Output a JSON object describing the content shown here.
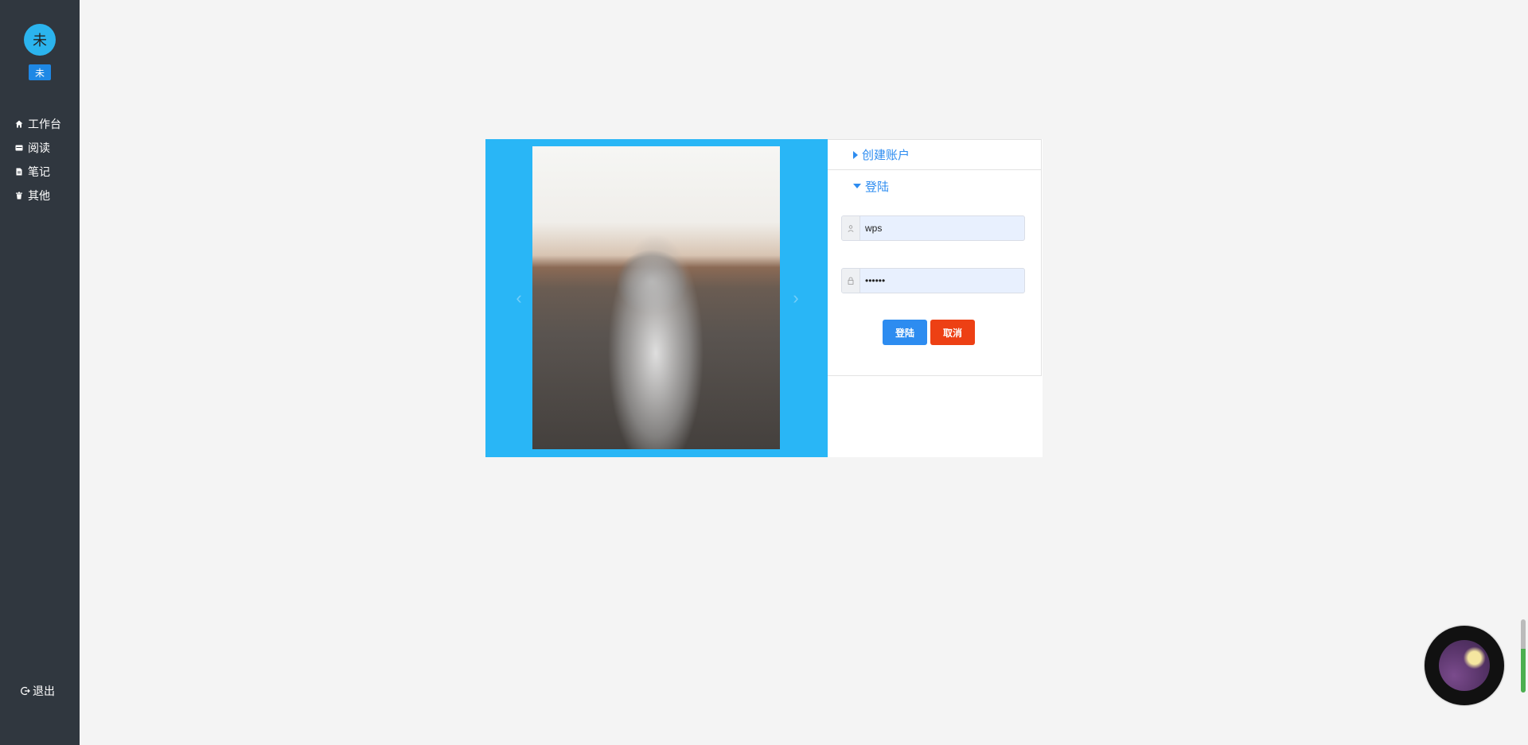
{
  "sidebar": {
    "avatar_text": "未",
    "user_badge": "未",
    "items": [
      {
        "label": "工作台",
        "icon": "home-icon"
      },
      {
        "label": "阅读",
        "icon": "book-icon"
      },
      {
        "label": "笔记",
        "icon": "note-icon"
      },
      {
        "label": "其他",
        "icon": "trash-icon"
      }
    ],
    "logout_label": "退出",
    "logout_icon": "logout-icon"
  },
  "carousel": {
    "prev_icon": "chevron-left-icon",
    "next_icon": "chevron-right-icon",
    "prev_glyph": "‹",
    "next_glyph": "›"
  },
  "accordion": {
    "create_account_label": "创建账户",
    "login_label": "登陆"
  },
  "login_form": {
    "username_value": "wps",
    "password_value": "••••••",
    "login_button": "登陆",
    "cancel_button": "取消"
  },
  "media_widget": {
    "volume": 0.6
  },
  "colors": {
    "sidebar_bg": "#30373f",
    "carousel_bg": "#29b6f6",
    "primary": "#2d8cf0",
    "danger": "#ed4014"
  }
}
